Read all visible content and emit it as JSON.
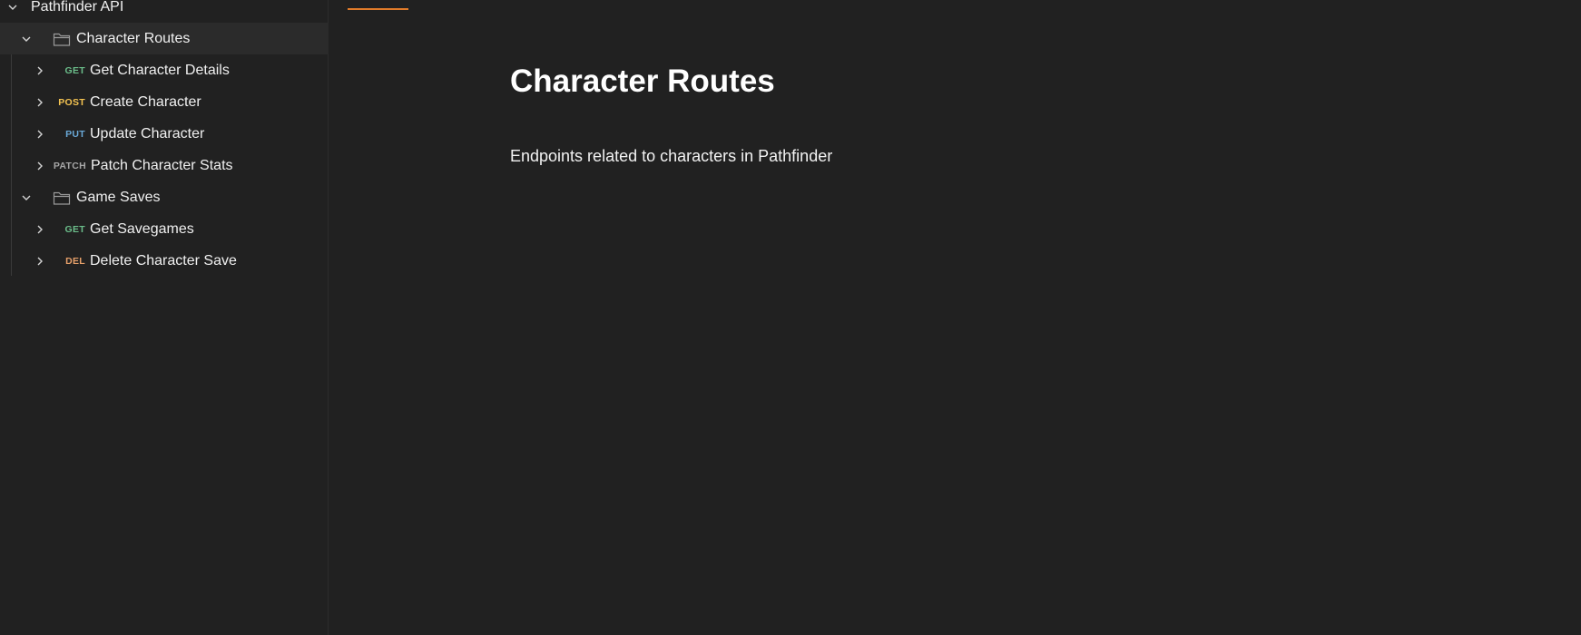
{
  "sidebar": {
    "collection": {
      "label": "Pathfinder API"
    },
    "folders": [
      {
        "label": "Character Routes",
        "requests": [
          {
            "method": "GET",
            "label": "Get Character Details",
            "color": "#6bbd8a"
          },
          {
            "method": "POST",
            "label": "Create Character",
            "color": "#f5c451"
          },
          {
            "method": "PUT",
            "label": "Update Character",
            "color": "#6aa9d8"
          },
          {
            "method": "PATCH",
            "label": "Patch Character Stats",
            "color": "#a7a7a7"
          }
        ]
      },
      {
        "label": "Game Saves",
        "requests": [
          {
            "method": "GET",
            "label": "Get Savegames",
            "color": "#6bbd8a"
          },
          {
            "method": "DEL",
            "label": "Delete Character Save",
            "color": "#e6a06a"
          }
        ]
      }
    ]
  },
  "main": {
    "title": "Character Routes",
    "description": "Endpoints related to characters in Pathfinder",
    "accent_color": "#e07b2a"
  }
}
